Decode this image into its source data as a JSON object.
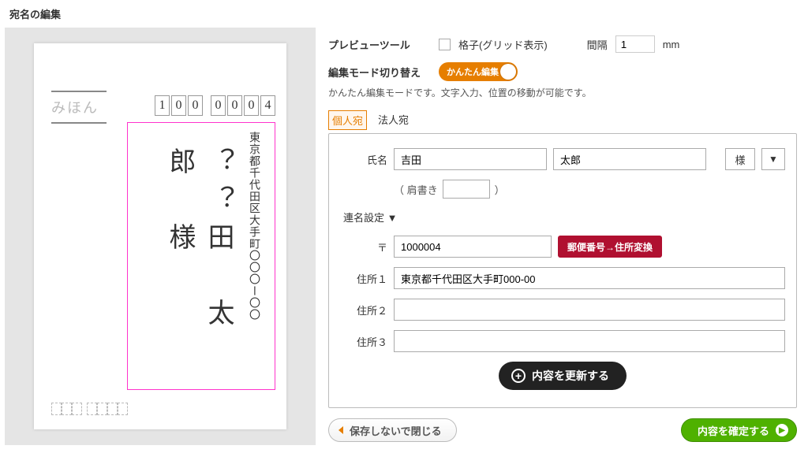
{
  "page_title": "宛名の編集",
  "preview": {
    "tools_label": "プレビューツール",
    "grid_label": "格子(グリッド表示)",
    "spacing_label": "間隔",
    "spacing_value": "1",
    "spacing_unit": "mm"
  },
  "mode": {
    "switch_label": "編集モード切り替え",
    "toggle_text": "かんたん編集",
    "hint": "かんたん編集モードです。文字入力、位置の移動が可能です。"
  },
  "tabs": {
    "personal": "個人宛",
    "corporate": "法人宛"
  },
  "form": {
    "name_label": "氏名",
    "family_name": "吉田",
    "given_name": "太郎",
    "honorific": "様",
    "shoulder_label": "（ 肩書き",
    "shoulder_close": "）",
    "renmei_label": "連名設定 ▼",
    "zip_label": "〒",
    "zip_value": "1000004",
    "convert_btn": "郵便番号→住所変換",
    "addr1_label": "住所１",
    "addr1_value": "東京都千代田区大手町000-00",
    "addr2_label": "住所２",
    "addr2_value": "",
    "addr3_label": "住所３",
    "addr3_value": "",
    "update_btn": "内容を更新する"
  },
  "footer": {
    "cancel": "保存しないで閉じる",
    "confirm": "内容を確定する"
  },
  "envelope": {
    "sample_mark": "みほん",
    "zip_digits": [
      "1",
      "0",
      "0",
      "0",
      "0",
      "0",
      "4"
    ],
    "address_vertical": "東京都千代田区大手町〇〇〇ー〇〇",
    "name_vertical": "？？田　太　郎　様"
  }
}
